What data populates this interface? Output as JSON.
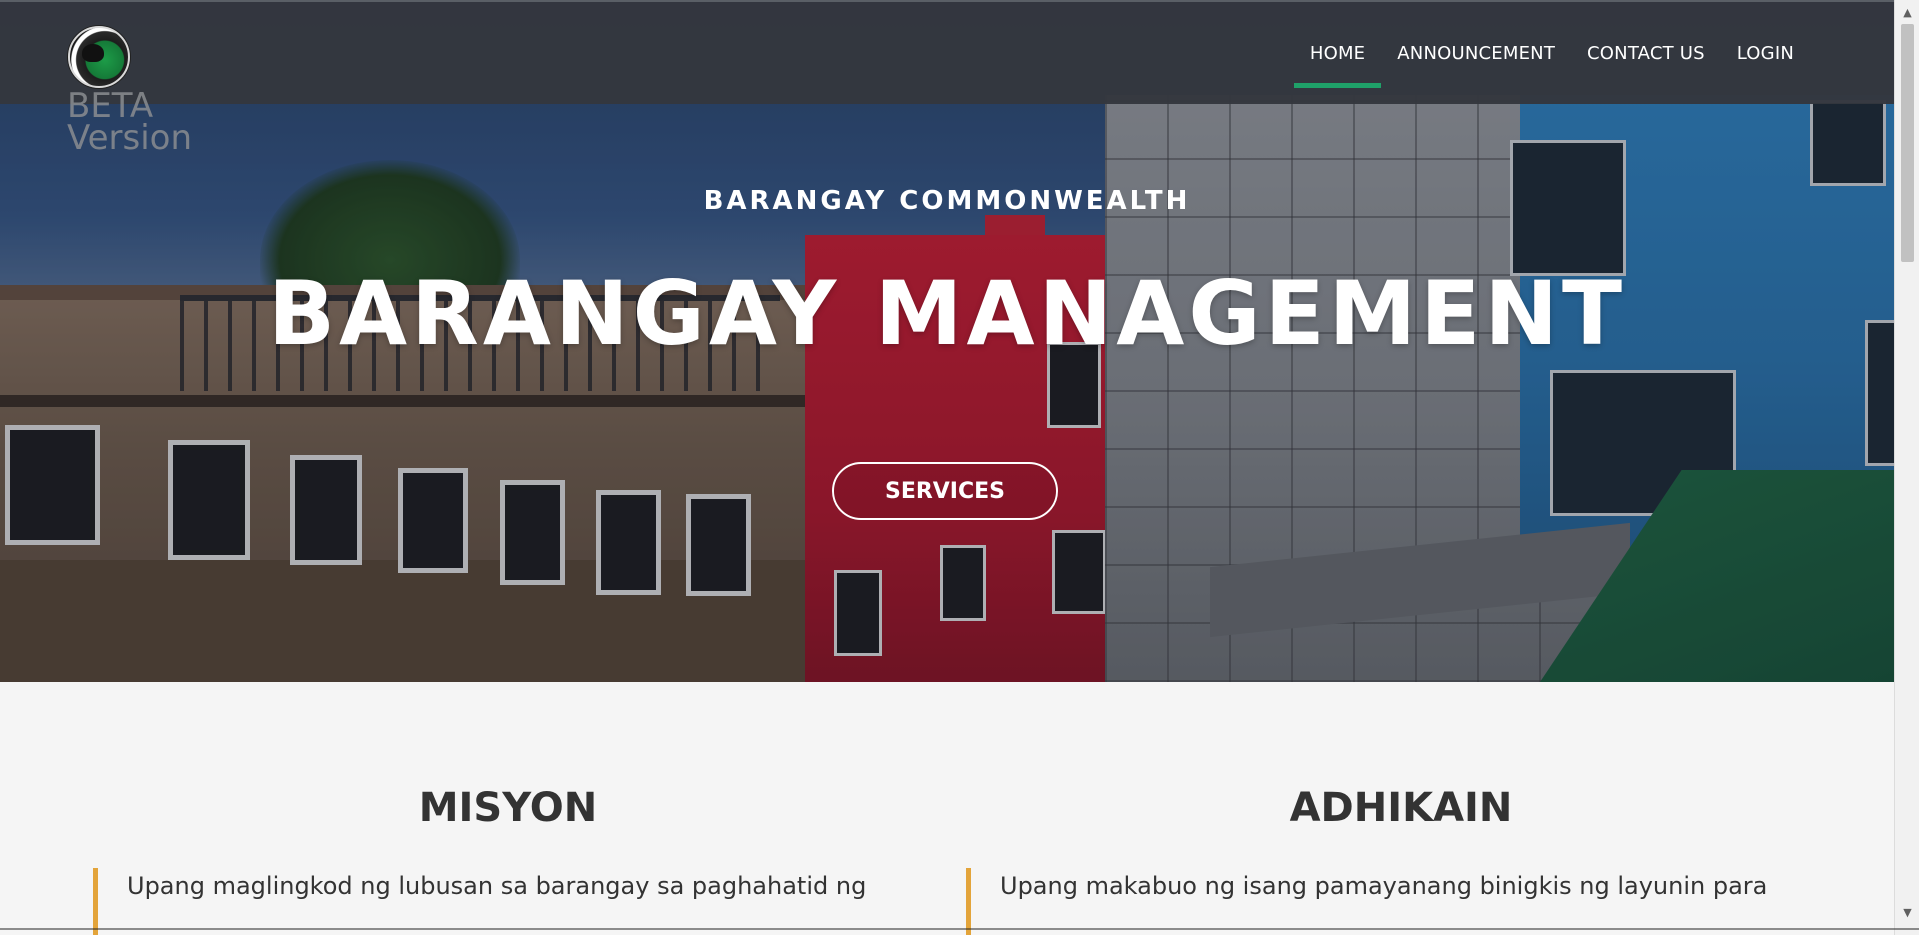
{
  "brand": {
    "logo_icon": "barangay-commonwealth-seal-icon",
    "beta_label_line1": "BETA",
    "beta_label_line2": "Version"
  },
  "nav": {
    "items": [
      {
        "label": "HOME",
        "active": true
      },
      {
        "label": "ANNOUNCEMENT",
        "active": false
      },
      {
        "label": "CONTACT US",
        "active": false
      },
      {
        "label": "LOGIN",
        "active": false
      }
    ],
    "active_indicator_color": "#1fa169"
  },
  "hero": {
    "subtitle": "BARANGAY COMMONWEALTH",
    "title": "BARANGAY MANAGEMENT",
    "button_label": "SERVICES"
  },
  "sections": {
    "mission": {
      "title": "MISYON",
      "text": "Upang maglingkod ng lubusan sa barangay sa paghahatid ng"
    },
    "vision": {
      "title": "ADHIKAIN",
      "text": "Upang makabuo ng isang pamayanang binigkis ng layunin para"
    },
    "accent_color": "#e3a43a"
  },
  "scrollbar": {
    "up_arrow_icon": "scroll-up-arrow-icon",
    "down_arrow_icon": "scroll-down-arrow-icon"
  }
}
